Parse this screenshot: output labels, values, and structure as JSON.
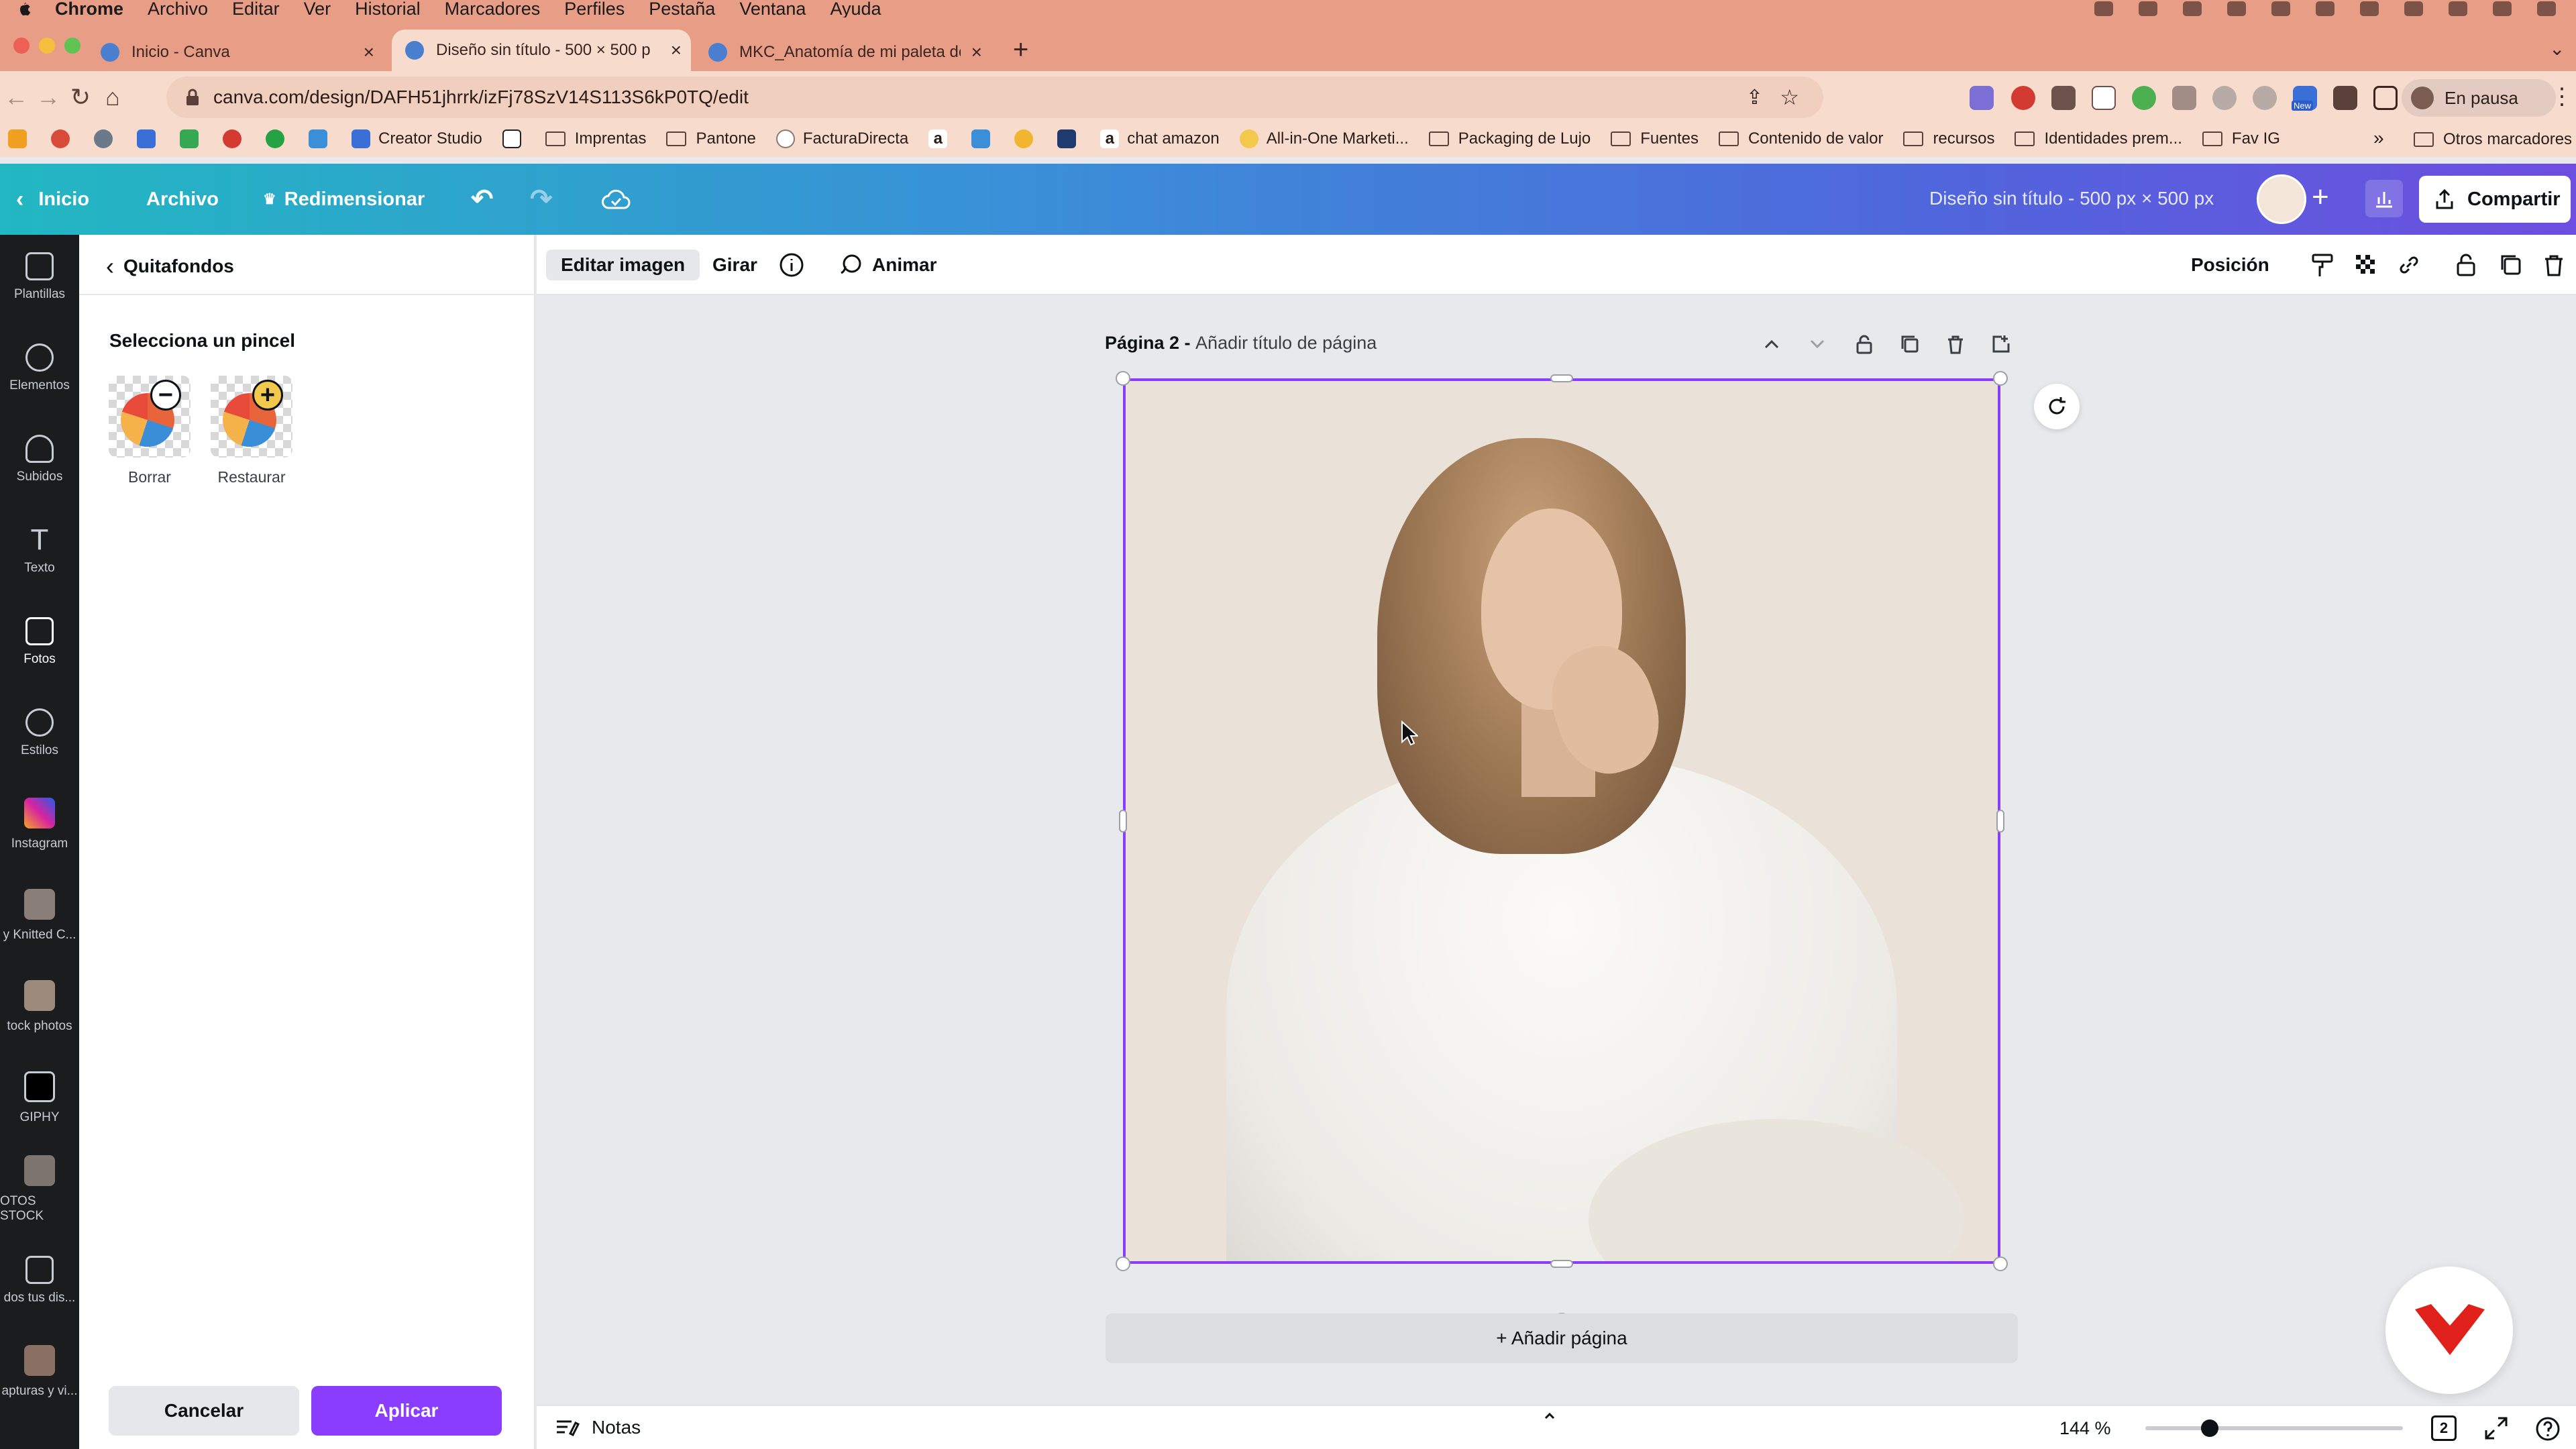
{
  "os_menu": {
    "app": "Chrome",
    "items": [
      "Archivo",
      "Editar",
      "Ver",
      "Historial",
      "Marcadores",
      "Perfiles",
      "Pestaña",
      "Ventana",
      "Ayuda"
    ]
  },
  "browser": {
    "tabs": [
      {
        "title": "Inicio - Canva",
        "active": false
      },
      {
        "title": "Diseño sin título - 500 × 500 p",
        "active": true
      },
      {
        "title": "MKC_Anatomía de mi paleta de",
        "active": false
      }
    ],
    "url": "canva.com/design/DAFH51jhrrk/izFj78SzV14S113S6kP0TQ/edit",
    "profile_status": "En pausa",
    "bookmarks": [
      "Creator Studio",
      "Imprentas",
      "Pantone",
      "FacturaDirecta",
      "chat amazon",
      "All-in-One Marketi...",
      "Packaging de Lujo",
      "Fuentes",
      "Contenido de valor",
      "recursos",
      "Identidades prem...",
      "Fav IG",
      "Otros marcadores"
    ],
    "new_badge": "New"
  },
  "canva_header": {
    "home": "Inicio",
    "file": "Archivo",
    "resize": "Redimensionar",
    "design_title": "Diseño sin título - 500 px × 500 px",
    "share": "Compartir"
  },
  "rail": [
    {
      "label": "Plantillas",
      "icon": "templates-icon"
    },
    {
      "label": "Elementos",
      "icon": "elements-icon"
    },
    {
      "label": "Subidos",
      "icon": "upload-icon"
    },
    {
      "label": "Texto",
      "icon": "text-icon"
    },
    {
      "label": "Fotos",
      "icon": "photos-icon"
    },
    {
      "label": "Estilos",
      "icon": "styles-icon"
    },
    {
      "label": "Instagram",
      "icon": "instagram-icon"
    },
    {
      "label": "y Knitted C...",
      "icon": "folder-thumb"
    },
    {
      "label": "tock photos",
      "icon": "folder-thumb"
    },
    {
      "label": "GIPHY",
      "icon": "giphy-icon"
    },
    {
      "label": "OTOS STOCK",
      "icon": "folder-thumb"
    },
    {
      "label": "dos tus dis...",
      "icon": "all-designs-icon"
    },
    {
      "label": "apturas y vi...",
      "icon": "folder-thumb"
    }
  ],
  "panel": {
    "back_label": "Quitafondos",
    "brush_title": "Selecciona un pincel",
    "brushes": [
      {
        "label": "Borrar"
      },
      {
        "label": "Restaurar"
      }
    ],
    "cancel": "Cancelar",
    "apply": "Aplicar"
  },
  "toolbar": {
    "edit_image": "Editar imagen",
    "rotate": "Girar",
    "animate": "Animar",
    "position": "Posición"
  },
  "page": {
    "label": "Página 2 - ",
    "title_placeholder": "Añadir título de página",
    "add_page": "+ Añadir página"
  },
  "footer": {
    "notes": "Notas",
    "zoom": "144 %",
    "zoom_level": 0.25,
    "page_count": "2"
  },
  "colors": {
    "accent": "#8b3dff",
    "header_gradient": [
      "#22b7c2",
      "#6d4ee0"
    ],
    "browser_chrome": "#e89d86"
  }
}
